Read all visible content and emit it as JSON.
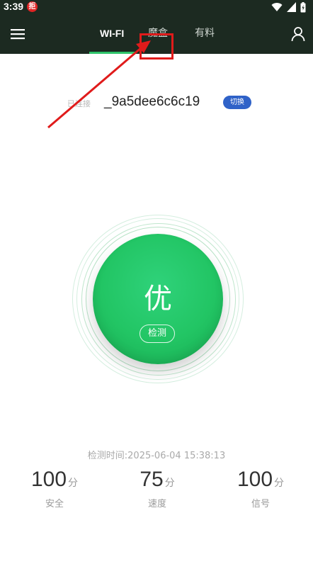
{
  "status_bar": {
    "time": "3:39",
    "notification_badge": "拒",
    "icons": [
      "wifi-icon",
      "signal-icon",
      "battery-icon"
    ]
  },
  "top_bar": {
    "tabs": [
      {
        "label": "WI-FI",
        "active": true
      },
      {
        "label": "魔盒",
        "active": false
      },
      {
        "label": "有料",
        "active": false
      }
    ],
    "menu_icon": "hamburger-menu-icon",
    "user_icon": "user-icon"
  },
  "connection": {
    "connected_label": "已连接",
    "ssid": "_9a5dee6c6c19",
    "switch_label": "切换"
  },
  "score": {
    "grade": "优",
    "detect_label": "检测"
  },
  "detect_time": "检测时间:2025-06-04 15:38:13",
  "stats": [
    {
      "value": "100",
      "unit": "分",
      "label": "安全"
    },
    {
      "value": "75",
      "unit": "分",
      "label": "速度"
    },
    {
      "value": "100",
      "unit": "分",
      "label": "信号"
    }
  ],
  "colors": {
    "header_bg": "#1c2a21",
    "accent_green": "#22c564",
    "switch_blue": "#2f62c8",
    "annotation_red": "#e01b1b"
  }
}
